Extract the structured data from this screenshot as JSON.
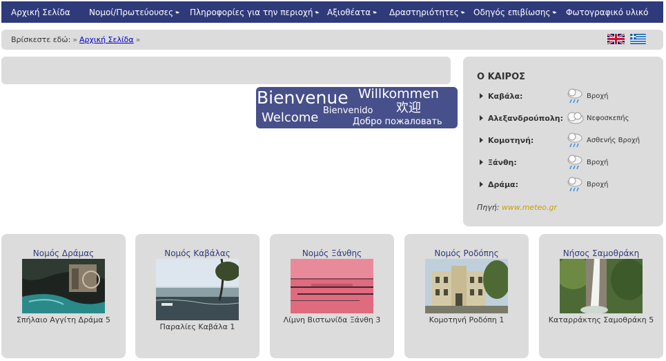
{
  "nav": {
    "items": [
      {
        "label": "Αρχική Σελίδα",
        "dropdown": false
      },
      {
        "label": "Νομοί/Πρωτεύουσες",
        "dropdown": true
      },
      {
        "label": "Πληροφορίες για την περιοχή",
        "dropdown": true
      },
      {
        "label": "Αξιοθέατα",
        "dropdown": true
      },
      {
        "label": "Δραστηριότητες",
        "dropdown": true
      },
      {
        "label": "Οδηγός επιβίωσης",
        "dropdown": true
      },
      {
        "label": "Φωτογραφικό υλικό",
        "dropdown": false
      }
    ]
  },
  "breadcrumb": {
    "prefix": "Βρίσκεστε εδώ:",
    "sep": "»",
    "link": "Αρχική Σελίδα",
    "sep_end": "»"
  },
  "welcome": {
    "words": [
      "Bienvenue",
      "Willkommen",
      "Bienvenido",
      "欢迎",
      "Welcome",
      "Добро пожаловать"
    ]
  },
  "weather": {
    "title": "Ο ΚΑΙΡΟΣ",
    "rows": [
      {
        "city": "Καβάλα:",
        "condition": "Βροχή",
        "icon": "rain-cloud-icon"
      },
      {
        "city": "Αλεξανδρούπολη:",
        "condition": "Νεφοσκεπής",
        "icon": "cloud-icon"
      },
      {
        "city": "Κομοτηνή:",
        "condition": "Ασθενής Βροχή",
        "icon": "rain-cloud-icon"
      },
      {
        "city": "Ξάνθη:",
        "condition": "Βροχή",
        "icon": "rain-cloud-icon"
      },
      {
        "city": "Δράμα:",
        "condition": "Βροχή",
        "icon": "rain-cloud-icon"
      }
    ],
    "source_label": "Πηγή:",
    "source_link": "www.meteo.gr"
  },
  "cards": [
    {
      "title": "Νομός Δράμας",
      "caption": "Σπήλαιο Αγγίτη Δράμα 5"
    },
    {
      "title": "Νομός Καβάλας",
      "caption": "Παραλίες Καβάλα 1"
    },
    {
      "title": "Νομός Ξάνθης",
      "caption": "Λίμνη Βιστωνίδα Ξάνθη 3"
    },
    {
      "title": "Νομός Ροδόπης",
      "caption": "Κομοτηνή Ροδόπη 1"
    },
    {
      "title": "Νήσος Σαμοθράκη",
      "caption": "Καταρράκτης Σαμοθράκη 5"
    }
  ],
  "colors": {
    "nav_bg": "#2e3a7a",
    "panel_bg": "#dcdcdc",
    "welcome_bg": "#47508a",
    "card_title": "#2e3a7a",
    "source_link": "#c8a000"
  }
}
